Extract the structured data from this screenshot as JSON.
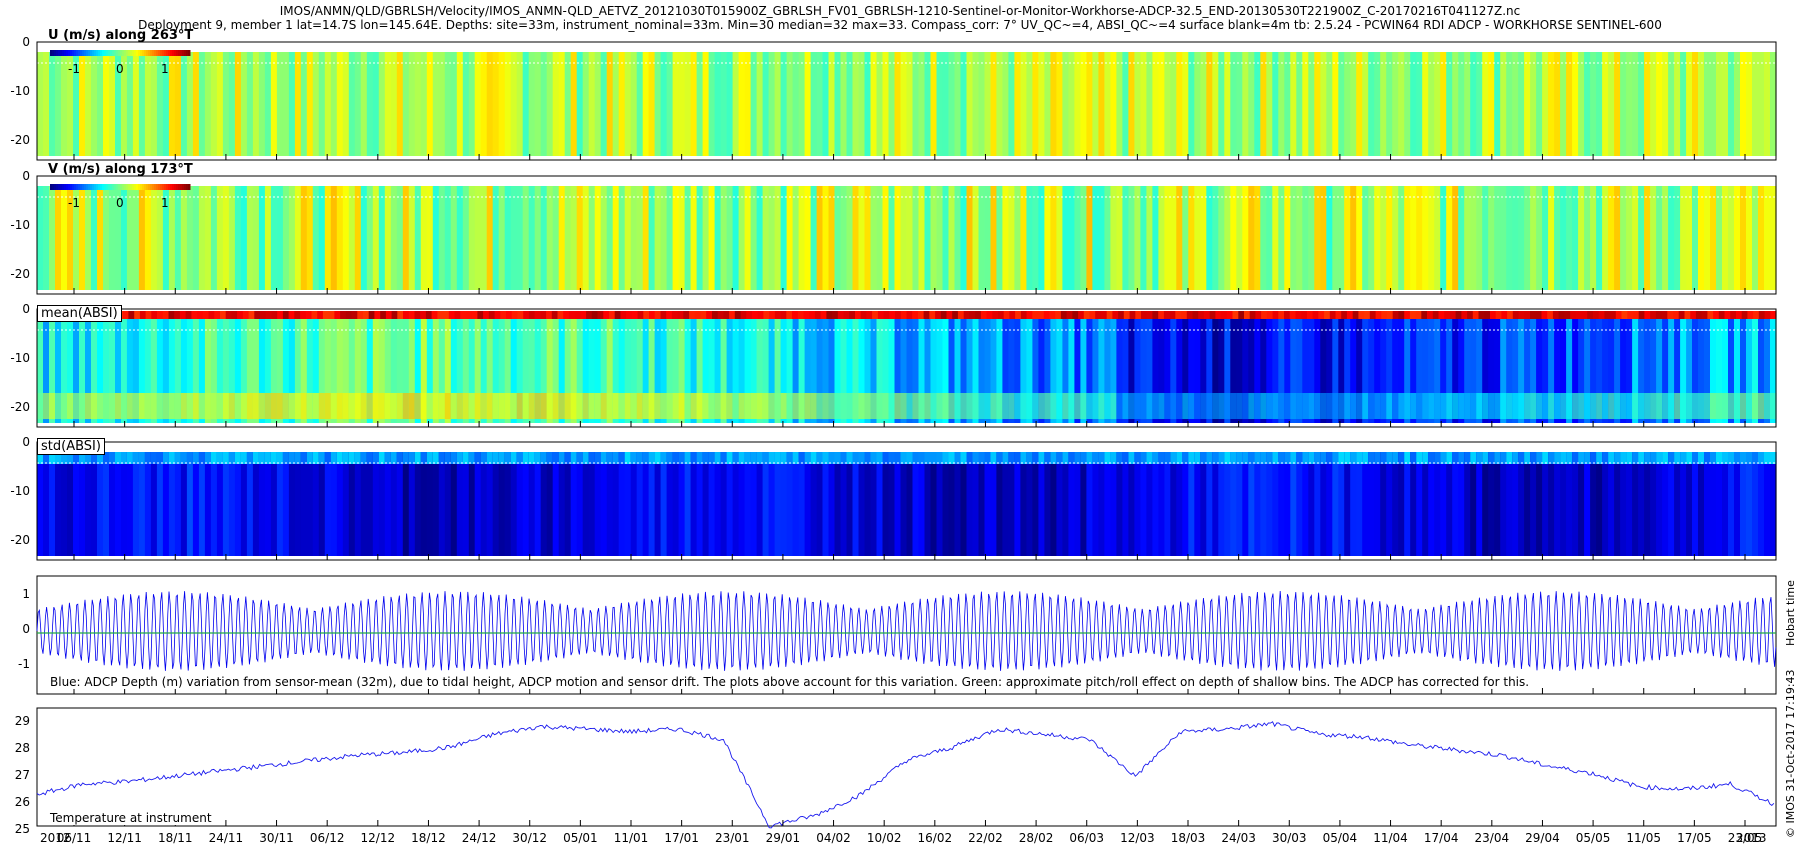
{
  "header": {
    "line1": "IMOS/ANMN/QLD/GBRLSH/Velocity/IMOS_ANMN-QLD_AETVZ_20121030T015900Z_GBRLSH_FV01_GBRLSH-1210-Sentinel-or-Monitor-Workhorse-ADCP-32.5_END-20130530T221900Z_C-20170216T041127Z.nc",
    "line2": "Deployment 9, member 1 lat=14.7S lon=145.64E. Depths: site=33m, instrument_nominal=33m. Min=30 median=32 max=33. Compass_corr: 7° UV_QC~=4, ABSI_QC~=4 surface blank=4m tb: 2.5.24 - PCWIN64 RDI ADCP - WORKHORSE SENTINEL-600"
  },
  "panels": {
    "u": {
      "title": "U (m/s) along 263°T",
      "yticks": [
        "0",
        "-10",
        "-20"
      ],
      "cbar_ticks": [
        "-1",
        "0",
        "1"
      ]
    },
    "v": {
      "title": "V (m/s) along 173°T",
      "yticks": [
        "0",
        "-10",
        "-20"
      ],
      "cbar_ticks": [
        "-1",
        "0",
        "1"
      ]
    },
    "mean": {
      "title": "mean(ABSI)",
      "yticks": [
        "0",
        "-10",
        "-20"
      ]
    },
    "std": {
      "title": "std(ABSI)",
      "yticks": [
        "0",
        "-10",
        "-20"
      ]
    },
    "depth": {
      "yticks": [
        "1",
        "0",
        "-1"
      ],
      "caption": "Blue: ADCP Depth (m) variation from sensor-mean (32m), due to tidal height, ADCP motion and sensor drift. The plots above account for this variation. Green: approximate pitch/roll effect on depth of shallow bins. The ADCP has corrected for this."
    },
    "temp": {
      "caption": "Temperature at instrument",
      "yticks": [
        "29",
        "28",
        "27",
        "26",
        "25"
      ]
    }
  },
  "side_text": {
    "timezone": "Hobart time",
    "credit": "© IMOS 31-Oct-2017 17:19:43"
  },
  "x_axis": {
    "year_start": "2012",
    "year_end": "2013",
    "labels": [
      "06/11",
      "12/11",
      "18/11",
      "24/11",
      "30/11",
      "06/12",
      "12/12",
      "18/12",
      "24/12",
      "30/12",
      "05/01",
      "11/01",
      "17/01",
      "23/01",
      "29/01",
      "04/02",
      "10/02",
      "16/02",
      "22/02",
      "28/02",
      "06/03",
      "12/03",
      "18/03",
      "24/03",
      "30/03",
      "05/04",
      "11/04",
      "17/04",
      "23/04",
      "29/04",
      "05/05",
      "11/05",
      "17/05",
      "23/05"
    ]
  },
  "colors": {
    "depth_line": "#0000ee",
    "pitch_line": "#22aa44",
    "temp_line": "#1a1aee"
  },
  "chart_data": [
    {
      "type": "heatmap",
      "title": "U (m/s) along 263°T",
      "y_range": [
        -23,
        0
      ],
      "color_range": [
        -1.5,
        1.5
      ],
      "description_value": "mostly near 0 (green), with alternating positive/negative streaks"
    },
    {
      "type": "heatmap",
      "title": "V (m/s) along 173°T",
      "y_range": [
        -23,
        0
      ],
      "color_range": [
        -1.5,
        1.5
      ]
    },
    {
      "type": "heatmap",
      "title": "mean(ABSI)",
      "y_range": [
        -23,
        0
      ]
    },
    {
      "type": "heatmap",
      "title": "std(ABSI)",
      "y_range": [
        -23,
        0
      ]
    },
    {
      "type": "line",
      "series": [
        {
          "name": "Blue",
          "values_description": "tidal oscillation, amplitude up to ~1.5 m"
        },
        {
          "name": "Green",
          "values": [
            0,
            0
          ]
        }
      ],
      "ylim": [
        -1.5,
        1.5
      ]
    },
    {
      "type": "line",
      "ylim": [
        25,
        29.5
      ],
      "x": [
        "30/10",
        "06/11",
        "12/11",
        "18/11",
        "24/11",
        "30/11",
        "06/12",
        "12/12",
        "18/12",
        "24/12",
        "30/12",
        "05/01",
        "11/01",
        "17/01",
        "21/01",
        "23/01",
        "24/01",
        "29/01",
        "04/02",
        "10/02",
        "16/02",
        "22/02",
        "28/02",
        "06/03",
        "09/03",
        "12/03",
        "18/03",
        "24/03",
        "30/03",
        "05/04",
        "11/04",
        "17/04",
        "23/04",
        "29/04",
        "05/05",
        "11/05",
        "17/05",
        "23/05",
        "29/05"
      ],
      "series": [
        {
          "name": "Temperature at instrument",
          "values": [
            26.2,
            26.6,
            26.7,
            26.9,
            27.1,
            27.3,
            27.5,
            27.7,
            27.8,
            28.0,
            28.5,
            28.8,
            28.7,
            28.6,
            28.7,
            28.3,
            25.0,
            25.4,
            26.2,
            27.5,
            28.0,
            28.7,
            28.5,
            28.3,
            26.9,
            28.6,
            28.7,
            28.9,
            28.5,
            28.4,
            28.1,
            27.9,
            27.7,
            27.3,
            27.0,
            26.5,
            26.4,
            26.6,
            25.8
          ]
        }
      ]
    }
  ]
}
